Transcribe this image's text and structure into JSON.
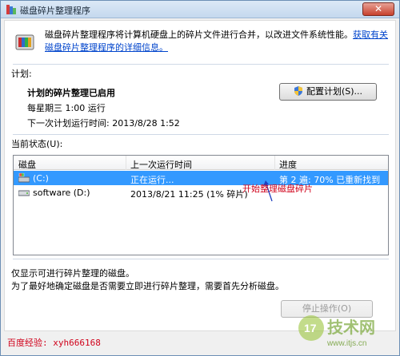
{
  "window": {
    "title": "磁盘碎片整理程序"
  },
  "intro": {
    "text": "磁盘碎片整理程序将计算机硬盘上的碎片文件进行合并，以改进文件系统性能。",
    "link": "获取有关磁盘碎片整理程序的详细信息。"
  },
  "schedule": {
    "section_label": "计划:",
    "status": "计划的碎片整理已启用",
    "frequency": "每星期三  1:00 运行",
    "next_run": "下一次计划运行时间: 2013/8/28 1:52",
    "configure_button": "配置计划(S)..."
  },
  "current_status": {
    "label": "当前状态(U):",
    "columns": [
      "磁盘",
      "上一次运行时间",
      "进度"
    ],
    "rows": [
      {
        "disk": "(C:)",
        "last_run": "正在运行...",
        "progress": "第 2 遍: 70% 已重新找到",
        "selected": true
      },
      {
        "disk": "software (D:)",
        "last_run": "2013/8/21 11:25 (1% 碎片)",
        "progress": "",
        "selected": false
      }
    ]
  },
  "annotation": "开始整理磁盘碎片",
  "footer": {
    "note1": "仅显示可进行碎片整理的磁盘。",
    "note2": "为了最好地确定磁盘是否需要立即进行碎片整理，需要首先分析磁盘。",
    "stop_button": "停止操作(O)"
  },
  "watermark": {
    "left_text": "百度经验: xyh666168",
    "site_text": "技术网",
    "site_url": "www.itjs.cn"
  }
}
